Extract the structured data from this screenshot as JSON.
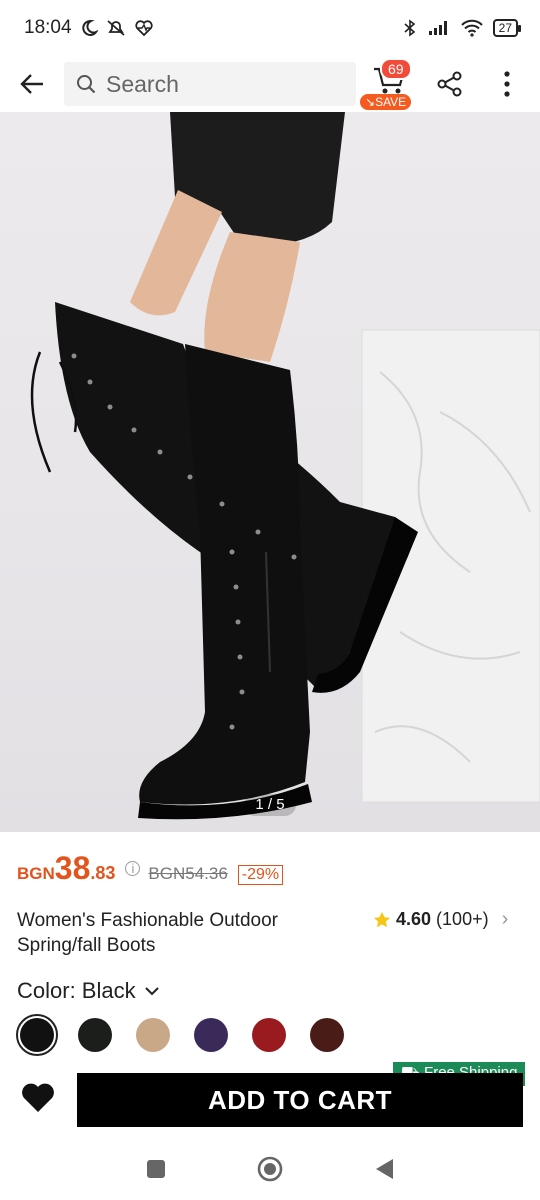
{
  "status": {
    "time": "18:04",
    "battery": "27"
  },
  "search": {
    "placeholder": "Search"
  },
  "cart": {
    "count": "69",
    "save_label": "SAVE"
  },
  "gallery": {
    "pager": "1 / 5"
  },
  "product": {
    "currency": "BGN",
    "price_whole": "38",
    "price_dec": ".83",
    "old_price": "BGN54.36",
    "discount": "-29%",
    "title": "Women's Fashionable Outdoor Spring/fall Boots",
    "rating": "4.60",
    "reviews": "(100+)"
  },
  "color": {
    "label": "Color: Black",
    "swatches": [
      "#111111",
      "#1b1e1a",
      "#c8a887",
      "#3a2a5a",
      "#9a1b1f",
      "#4a1c18"
    ]
  },
  "shipping": {
    "label": "Free Shipping"
  },
  "actions": {
    "add_to_cart": "ADD TO CART"
  },
  "colors": {
    "accent": "#e2541c",
    "badge": "#f24b3a",
    "ship": "#1d8b58"
  }
}
